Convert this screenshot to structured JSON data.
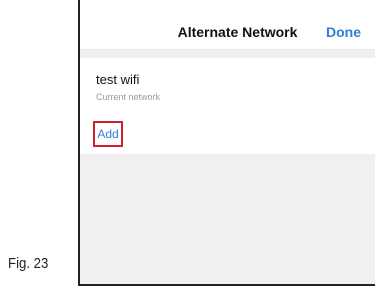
{
  "figure": {
    "label": "Fig. 23"
  },
  "nav": {
    "title": "Alternate Network",
    "done_label": "Done"
  },
  "network": {
    "name": "test wifi",
    "status": "Current network"
  },
  "actions": {
    "add_label": "Add"
  },
  "colors": {
    "accent": "#2f80d6",
    "highlight": "#d0202a",
    "background": "#f0f0f0"
  }
}
